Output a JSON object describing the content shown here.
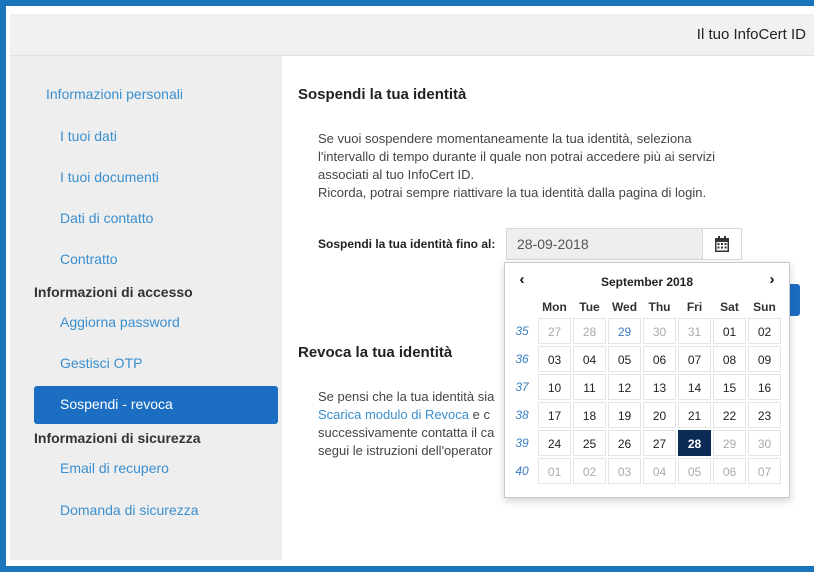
{
  "header": {
    "title": "Il tuo InfoCert ID"
  },
  "sidebar": {
    "section1": "Informazioni personali",
    "items1": [
      "I tuoi dati",
      "I tuoi documenti",
      "Dati di contatto",
      "Contratto"
    ],
    "section2": "Informazioni di accesso",
    "items2": [
      "Aggiorna password",
      "Gestisci OTP"
    ],
    "active": "Sospendi - revoca",
    "section3": "Informazioni di sicurezza",
    "items3": [
      "Email di recupero",
      "Domanda di sicurezza"
    ]
  },
  "suspend": {
    "title": "Sospendi la tua identità",
    "lines": [
      "Se vuoi sospendere momentaneamente la tua identità, seleziona",
      "l'intervallo di tempo durante il quale non potrai accedere più ai servizi",
      "associati al tuo InfoCert ID.",
      "Ricorda, potrai sempre riattivare la tua identità dalla pagina di login."
    ],
    "field_label": "Sospendi la tua identità fino al:",
    "date_value": "28-09-2018",
    "calendar_icon": "calendar-icon"
  },
  "revoke": {
    "title": "Revoca la tua identità",
    "line1": "Se pensi che la tua identità sia",
    "link": "Scarica modulo di Revoca",
    "line2_rest": " e c",
    "line3": "successivamente contatta il ca",
    "line4": "segui le istruzioni dell'operator"
  },
  "calendar": {
    "prev": "‹",
    "next": "›",
    "title": "September 2018",
    "weekdays": [
      "Mon",
      "Tue",
      "Wed",
      "Thu",
      "Fri",
      "Sat",
      "Sun"
    ],
    "weeks": [
      {
        "num": "35",
        "days": [
          {
            "d": "27",
            "m": true
          },
          {
            "d": "28",
            "m": true
          },
          {
            "d": "29",
            "m": false,
            "blue": true
          },
          {
            "d": "30",
            "m": true
          },
          {
            "d": "31",
            "m": true
          },
          {
            "d": "01",
            "m": false
          },
          {
            "d": "02",
            "m": false
          }
        ]
      },
      {
        "num": "36",
        "days": [
          {
            "d": "03"
          },
          {
            "d": "04"
          },
          {
            "d": "05"
          },
          {
            "d": "06"
          },
          {
            "d": "07"
          },
          {
            "d": "08"
          },
          {
            "d": "09"
          }
        ]
      },
      {
        "num": "37",
        "days": [
          {
            "d": "10"
          },
          {
            "d": "11"
          },
          {
            "d": "12"
          },
          {
            "d": "13"
          },
          {
            "d": "14"
          },
          {
            "d": "15"
          },
          {
            "d": "16"
          }
        ]
      },
      {
        "num": "38",
        "days": [
          {
            "d": "17"
          },
          {
            "d": "18"
          },
          {
            "d": "19"
          },
          {
            "d": "20"
          },
          {
            "d": "21"
          },
          {
            "d": "22"
          },
          {
            "d": "23"
          }
        ]
      },
      {
        "num": "39",
        "days": [
          {
            "d": "24"
          },
          {
            "d": "25"
          },
          {
            "d": "26"
          },
          {
            "d": "27"
          },
          {
            "d": "28",
            "sel": true
          },
          {
            "d": "29",
            "m": true
          },
          {
            "d": "30",
            "m": true
          }
        ]
      },
      {
        "num": "40",
        "days": [
          {
            "d": "01",
            "m": true
          },
          {
            "d": "02",
            "m": true
          },
          {
            "d": "03",
            "m": true
          },
          {
            "d": "04",
            "m": true
          },
          {
            "d": "05",
            "m": true
          },
          {
            "d": "06",
            "m": true
          },
          {
            "d": "07",
            "m": true
          }
        ]
      }
    ]
  },
  "colors": {
    "accent": "#1b6ec2",
    "selected": "#0b2d55",
    "link": "#3a8fcf"
  }
}
